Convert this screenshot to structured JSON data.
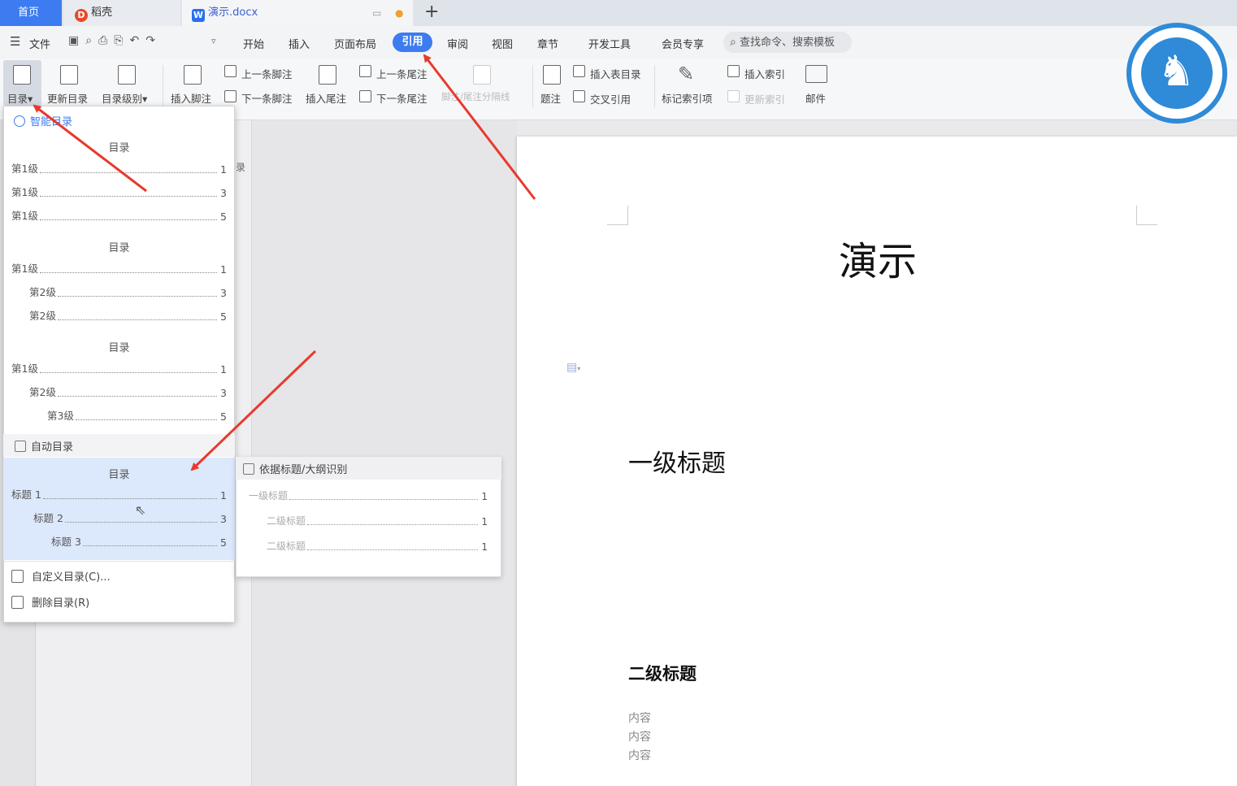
{
  "tabs": {
    "home": "首页",
    "shell": "稻壳",
    "document": "演示.docx"
  },
  "menu": {
    "file": "文件",
    "items": [
      "开始",
      "插入",
      "页面布局",
      "引用",
      "审阅",
      "视图",
      "章节",
      "开发工具",
      "会员专享"
    ],
    "active": "引用",
    "search_placeholder": "查找命令、搜索模板"
  },
  "ribbon": {
    "toc": "目录",
    "update_toc": "更新目录",
    "toc_level": "目录级别",
    "insert_footnote": "插入脚注",
    "prev_footnote": "上一条脚注",
    "next_footnote": "下一条脚注",
    "insert_endnote": "插入尾注",
    "prev_endnote": "上一条尾注",
    "next_endnote": "下一条尾注",
    "separator": "脚注/尾注分隔线",
    "caption": "题注",
    "insert_table_of_figures": "插入表目录",
    "cross_reference": "交叉引用",
    "mark_index_entry": "标记索引项",
    "insert_index": "插入索引",
    "update_index": "更新索引",
    "mail": "邮件"
  },
  "dropdown": {
    "smart_toc_header": "智能目录",
    "auto_toc_header": "自动目录",
    "smart_tocs": [
      {
        "title": "目录",
        "rows": [
          {
            "label": "第1级",
            "page": "1",
            "indent": 0
          },
          {
            "label": "第1级",
            "page": "3",
            "indent": 0
          },
          {
            "label": "第1级",
            "page": "5",
            "indent": 0
          }
        ]
      },
      {
        "title": "目录",
        "rows": [
          {
            "label": "第1级",
            "page": "1",
            "indent": 0
          },
          {
            "label": "第2级",
            "page": "3",
            "indent": 1
          },
          {
            "label": "第2级",
            "page": "5",
            "indent": 1
          }
        ]
      },
      {
        "title": "目录",
        "rows": [
          {
            "label": "第1级",
            "page": "1",
            "indent": 0
          },
          {
            "label": "第2级",
            "page": "3",
            "indent": 1
          },
          {
            "label": "第3级",
            "page": "5",
            "indent": 2
          }
        ]
      }
    ],
    "auto_toc": {
      "title": "目录",
      "rows": [
        {
          "label": "标题 1",
          "page": "1",
          "indent": 0
        },
        {
          "label": "标题 2",
          "page": "3",
          "indent": 1
        },
        {
          "label": "标题 3",
          "page": "5",
          "indent": 2
        }
      ]
    },
    "custom_toc": "自定义目录(C)...",
    "delete_toc": "删除目录(R)"
  },
  "submenu": {
    "header": "依据标题/大纲识别",
    "rows": [
      {
        "label": "一级标题",
        "page": "1",
        "indent": 0
      },
      {
        "label": "二级标题",
        "page": "1",
        "indent": 1
      },
      {
        "label": "二级标题",
        "page": "1",
        "indent": 1
      }
    ]
  },
  "nav_partial_text": "录",
  "document": {
    "title": "演示",
    "heading1": "一级标题",
    "heading2": "二级标题",
    "content": [
      "内容",
      "内容",
      "内容"
    ]
  },
  "colors": {
    "accent": "#3c7cf0",
    "arrow": "#e83a2e",
    "logo": "#2f8ad8"
  }
}
